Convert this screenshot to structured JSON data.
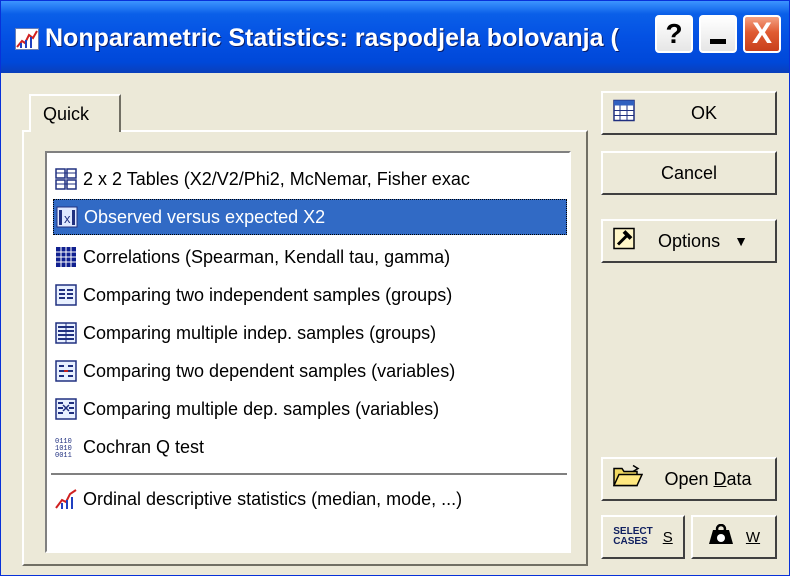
{
  "window": {
    "title": "Nonparametric Statistics: raspodjela bolovanja (",
    "help_label": "?",
    "close_label": "X"
  },
  "tabs": [
    {
      "label": "Quick"
    }
  ],
  "list": {
    "items": [
      {
        "label": "2 x 2 Tables (X2/V2/Phi2, McNemar, Fisher exac",
        "icon": "table-2x2-icon",
        "selected": false
      },
      {
        "label": "Observed versus expected X2",
        "icon": "observed-expected-icon",
        "selected": true
      },
      {
        "label": "Correlations (Spearman, Kendall tau, gamma)",
        "icon": "correlation-matrix-icon",
        "selected": false
      },
      {
        "label": "Comparing two independent samples (groups)",
        "icon": "two-independent-icon",
        "selected": false
      },
      {
        "label": "Comparing multiple indep. samples (groups)",
        "icon": "multiple-independent-icon",
        "selected": false
      },
      {
        "label": "Comparing two dependent samples (variables)",
        "icon": "two-dependent-icon",
        "selected": false
      },
      {
        "label": "Comparing multiple dep. samples (variables)",
        "icon": "multiple-dependent-icon",
        "selected": false
      },
      {
        "label": "Cochran Q test",
        "icon": "binary-data-icon",
        "selected": false
      },
      {
        "label": "Ordinal descriptive statistics (median, mode, ...)",
        "icon": "ordinal-chart-icon",
        "selected": false
      }
    ]
  },
  "buttons": {
    "ok": "OK",
    "cancel": "Cancel",
    "options": "Options",
    "options_arrow": "▼",
    "open_data_prefix": "Open ",
    "open_data_underlined": "D",
    "open_data_suffix": "ata",
    "select_cases_line1": "SELECT",
    "select_cases_line2": "CASES",
    "select_cases_key": "S",
    "weight_key": "W"
  },
  "colors": {
    "selection": "#316AC5",
    "titlebar": "#0451E3",
    "dialog_bg": "#ECE9D8",
    "close_button": "#E05B32"
  }
}
